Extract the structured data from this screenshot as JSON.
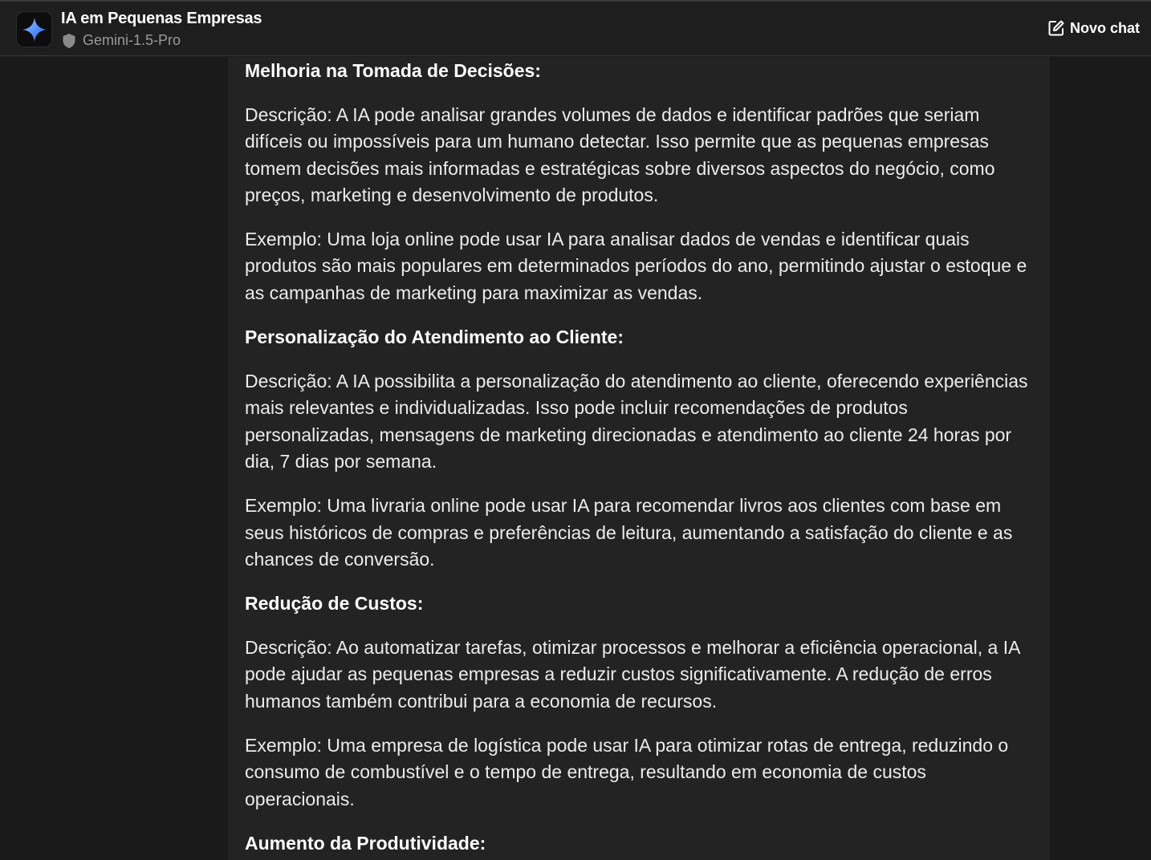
{
  "header": {
    "title": "IA em Pequenas Empresas",
    "model": "Gemini-1.5-Pro",
    "new_chat_label": "Novo chat",
    "icons": {
      "app": "gemini-sparkle-icon",
      "model": "shield-icon",
      "new_chat": "edit-icon"
    }
  },
  "sections": [
    {
      "heading": "Melhoria na Tomada de Decisões:",
      "description": "Descrição: A IA pode analisar grandes volumes de dados e identificar padrões que seriam difíceis ou impossíveis para um humano detectar. Isso permite que as pequenas empresas tomem decisões mais informadas e estratégicas sobre diversos aspectos do negócio, como preços, marketing e desenvolvimento de produtos.",
      "example": "Exemplo: Uma loja online pode usar IA para analisar dados de vendas e identificar quais produtos são mais populares em determinados períodos do ano, permitindo ajustar o estoque e as campanhas de marketing para maximizar as vendas."
    },
    {
      "heading": "Personalização do Atendimento ao Cliente:",
      "description": "Descrição: A IA possibilita a personalização do atendimento ao cliente, oferecendo experiências mais relevantes e individualizadas. Isso pode incluir recomendações de produtos personalizadas, mensagens de marketing direcionadas e atendimento ao cliente 24 horas por dia, 7 dias por semana.",
      "example": "Exemplo: Uma livraria online pode usar IA para recomendar livros aos clientes com base em seus históricos de compras e preferências de leitura, aumentando a satisfação do cliente e as chances de conversão."
    },
    {
      "heading": "Redução de Custos:",
      "description": "Descrição: Ao automatizar tarefas, otimizar processos e melhorar a eficiência operacional, a IA pode ajudar as pequenas empresas a reduzir custos significativamente. A redução de erros humanos também contribui para a economia de recursos.",
      "example": "Exemplo: Uma empresa de logística pode usar IA para otimizar rotas de entrega, reduzindo o consumo de combustível e o tempo de entrega, resultando em economia de custos operacionais."
    },
    {
      "heading": "Aumento da Produtividade:"
    }
  ],
  "colors": {
    "background": "#1a1a1a",
    "header": "#1e1e1e",
    "message": "#232323",
    "accent": "#6ea8ff"
  }
}
